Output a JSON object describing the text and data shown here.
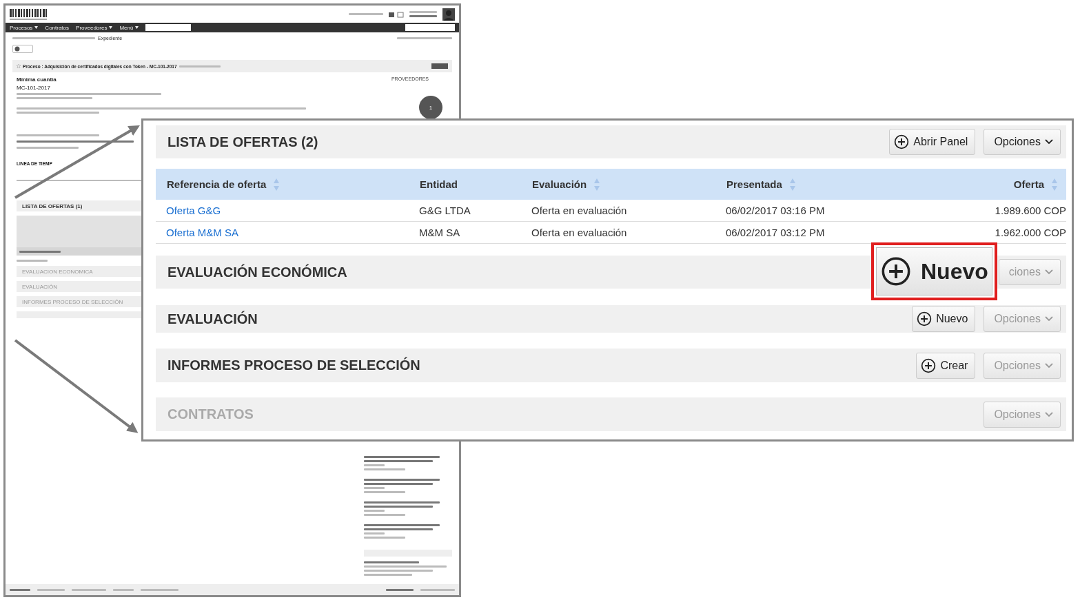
{
  "background_page": {
    "nav": [
      {
        "label": "Procesos",
        "menu": true
      },
      {
        "label": "Contratos",
        "menu": false
      },
      {
        "label": "Proveedores",
        "menu": true
      },
      {
        "label": "Menú",
        "menu": true
      }
    ],
    "breadcrumb_current": "Expediente",
    "process_title": "Proceso : Adquisición de certificados digitales con Token - MC-101-2017",
    "modality": "Mínima cuantía",
    "reference": "MC-101-2017",
    "providers_label": "PROVEEDORES",
    "providers_count": "1",
    "timeline_title": "LINEA DE TIEMP",
    "sections": [
      {
        "title": "LISTA DE OFERTAS (1)",
        "disabled": false
      },
      {
        "title": "EVALUACION ECONOMICA",
        "disabled": true
      },
      {
        "title": "EVALUACIÓN",
        "disabled": true
      },
      {
        "title": "INFORMES PROCESO DE SELECCIÓN",
        "disabled": true
      }
    ]
  },
  "offers_panel": {
    "title": "LISTA DE OFERTAS (2)",
    "buttons": [
      {
        "label": "Abrir Panel",
        "kind": "action",
        "disabled": false
      },
      {
        "label": "Opciones",
        "kind": "menu",
        "disabled": false
      }
    ],
    "columns": [
      {
        "label": "Referencia de oferta",
        "sortable": true
      },
      {
        "label": "Entidad",
        "sortable": false
      },
      {
        "label": "Evaluación",
        "sortable": true
      },
      {
        "label": "Presentada",
        "sortable": true
      },
      {
        "label": "Oferta",
        "sortable": true
      }
    ],
    "rows": [
      {
        "cells": [
          "Oferta G&G",
          "G&G LTDA",
          "Oferta en evaluación",
          "06/02/2017 03:16 PM",
          "1.989.600 COP"
        ]
      },
      {
        "cells": [
          "Oferta M&M SA",
          "M&M SA",
          "Oferta en evaluación",
          "06/02/2017 03:12 PM",
          "1.962.000 COP"
        ]
      }
    ]
  },
  "sections": [
    {
      "title": "EVALUACIÓN ECONÓMICA",
      "disabled": false,
      "buttons": [
        {
          "label": "ciones",
          "kind": "menu",
          "disabled": true
        }
      ]
    },
    {
      "title": "EVALUACIÓN",
      "disabled": false,
      "buttons": [
        {
          "label": "Nuevo",
          "kind": "action",
          "disabled": false
        },
        {
          "label": "Opciones",
          "kind": "menu",
          "disabled": true
        }
      ]
    },
    {
      "title": "INFORMES PROCESO DE SELECCIÓN",
      "disabled": false,
      "buttons": [
        {
          "label": "Crear",
          "kind": "action",
          "disabled": false
        },
        {
          "label": "Opciones",
          "kind": "menu",
          "disabled": true
        }
      ]
    },
    {
      "title": "CONTRATOS",
      "disabled": true,
      "buttons": [
        {
          "label": "Opciones",
          "kind": "menu",
          "disabled": true
        }
      ]
    }
  ],
  "highlight": {
    "label": "Nuevo"
  }
}
